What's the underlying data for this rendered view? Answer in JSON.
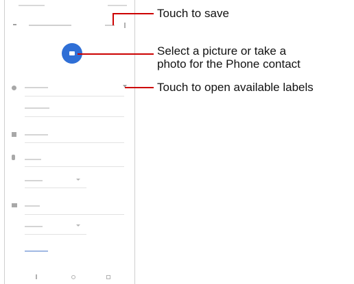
{
  "annotations": {
    "save": "Touch to save",
    "picture_line1": "Select a picture or take a",
    "picture_line2": "photo for the Phone contact",
    "labels": "Touch to open available labels"
  },
  "colors": {
    "accent": "#2f6fd6",
    "callout": "#cc0000"
  },
  "icons": {
    "back": "back-arrow-icon",
    "more": "more-vertical-icon",
    "camera": "camera-icon",
    "person": "person-icon",
    "business": "business-icon",
    "phone": "phone-icon",
    "email": "email-icon",
    "dropdown": "chevron-down-icon"
  }
}
